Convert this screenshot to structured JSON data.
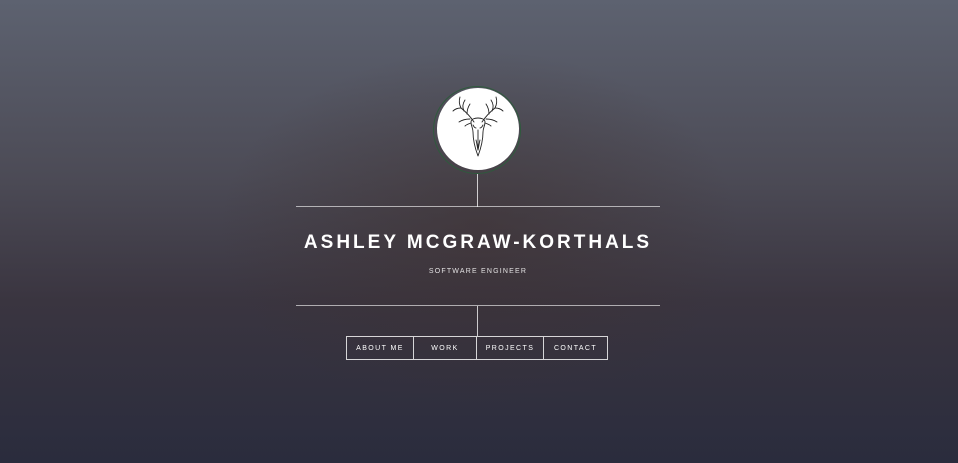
{
  "profile": {
    "name": "ASHLEY MCGRAW-KORTHALS",
    "title": "SOFTWARE ENGINEER",
    "logo_icon": "deer-skull-icon"
  },
  "nav": {
    "items": [
      {
        "label": "ABOUT ME"
      },
      {
        "label": "WORK"
      },
      {
        "label": "PROJECTS"
      },
      {
        "label": "CONTACT"
      }
    ]
  },
  "colors": {
    "background_top": "#5d6270",
    "background_bottom": "#2a2c3d",
    "logo_ring": "#2f5a3d",
    "text": "#ffffff"
  }
}
